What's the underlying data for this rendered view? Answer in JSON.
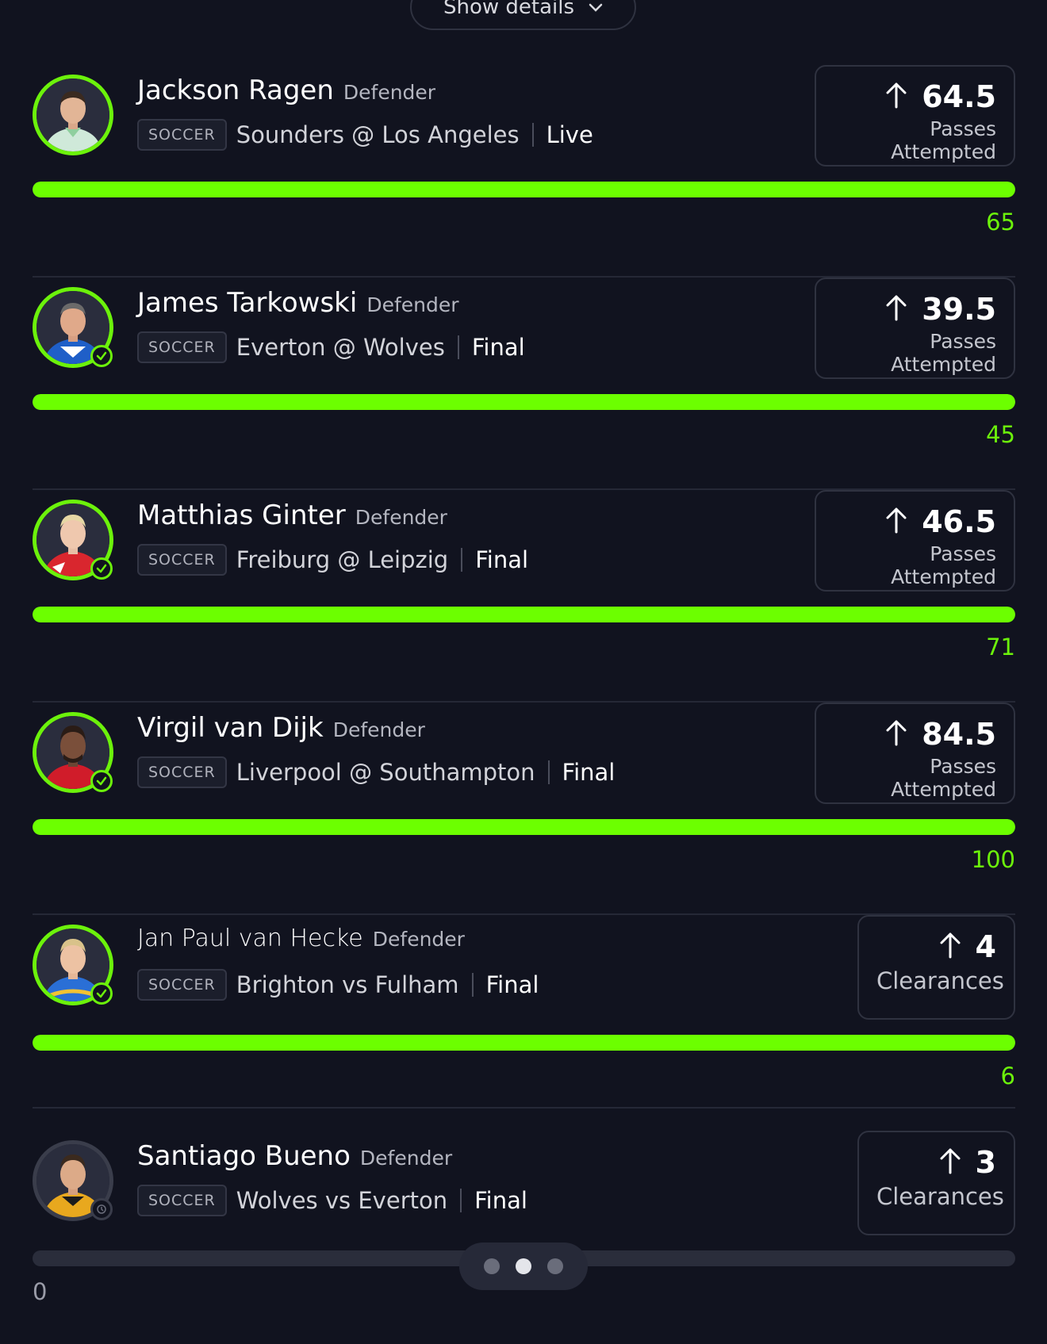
{
  "header": {
    "show_details_label": "Show details",
    "chevron_icon": "chevron-down-icon"
  },
  "colors": {
    "accent": "#6cff00",
    "background": "#11131f",
    "pending": "#3a3d4b"
  },
  "picks": [
    {
      "name": "Jackson Ragen",
      "position": "Defender",
      "sport": "SOCCER",
      "matchup": "Sounders @ Los Angeles",
      "status": "Live",
      "direction_icon": "arrow-up-icon",
      "line": "64.5",
      "stat": "Passes Attempted",
      "result": "65",
      "progress": 1.0,
      "settled": false
    },
    {
      "name": "James Tarkowski",
      "position": "Defender",
      "sport": "SOCCER",
      "matchup": "Everton @ Wolves",
      "status": "Final",
      "direction_icon": "arrow-up-icon",
      "line": "39.5",
      "stat": "Passes Attempted",
      "result": "45",
      "progress": 1.0,
      "settled": true
    },
    {
      "name": "Matthias Ginter",
      "position": "Defender",
      "sport": "SOCCER",
      "matchup": "Freiburg @ Leipzig",
      "status": "Final",
      "direction_icon": "arrow-up-icon",
      "line": "46.5",
      "stat": "Passes Attempted",
      "result": "71",
      "progress": 1.0,
      "settled": true
    },
    {
      "name": "Virgil van Dijk",
      "position": "Defender",
      "sport": "SOCCER",
      "matchup": "Liverpool @ Southampton",
      "status": "Final",
      "direction_icon": "arrow-up-icon",
      "line": "84.5",
      "stat": "Passes Attempted",
      "result": "100",
      "progress": 1.0,
      "settled": true
    },
    {
      "name": "Jan Paul van Hecke",
      "position": "Defender",
      "sport": "SOCCER",
      "matchup": "Brighton vs Fulham",
      "status": "Final",
      "direction_icon": "arrow-up-icon",
      "line": "4",
      "stat": "Clearances",
      "result": "6",
      "progress": 1.0,
      "settled": true
    },
    {
      "name": "Santiago Bueno",
      "position": "Defender",
      "sport": "SOCCER",
      "matchup": "Wolves vs Everton",
      "status": "Final",
      "direction_icon": "arrow-up-icon",
      "line": "3",
      "stat": "Clearances",
      "result": "0",
      "progress": 0.0,
      "settled": false
    }
  ],
  "pagination": {
    "count": 3,
    "active_index": 1
  }
}
